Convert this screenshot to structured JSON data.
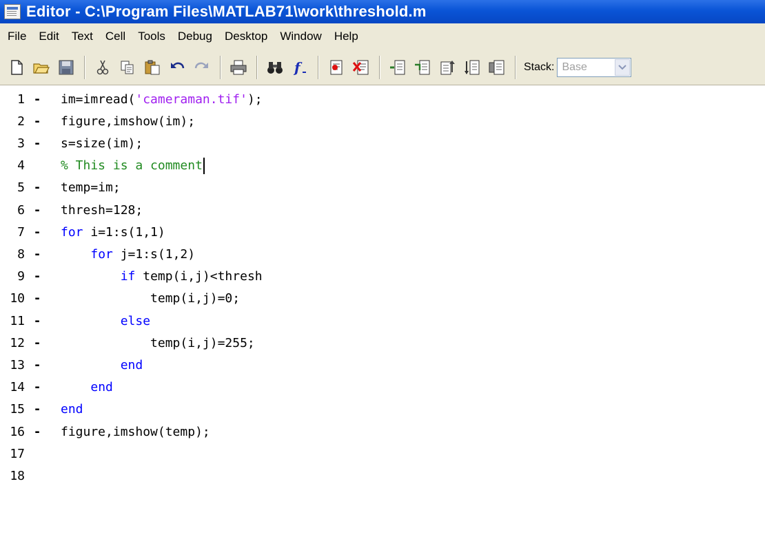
{
  "window": {
    "title": "Editor - C:\\Program Files\\MATLAB71\\work\\threshold.m"
  },
  "menu": [
    "File",
    "Edit",
    "Text",
    "Cell",
    "Tools",
    "Debug",
    "Desktop",
    "Window",
    "Help"
  ],
  "toolbar": {
    "stack_label": "Stack:",
    "stack_value": "Base",
    "buttons": [
      "new-file",
      "open",
      "save",
      "cut",
      "copy",
      "paste",
      "undo",
      "redo",
      "print",
      "find",
      "function",
      "set-breakpoint",
      "clear-breakpoints",
      "step",
      "step-in",
      "step-out",
      "continue",
      "exit-debug"
    ]
  },
  "editor": {
    "lines": [
      {
        "num": "1",
        "dash": "-",
        "indent": "",
        "parts": [
          {
            "t": "im=imread(",
            "c": ""
          },
          {
            "t": "'cameraman.tif'",
            "c": "str"
          },
          {
            "t": ");",
            "c": ""
          }
        ]
      },
      {
        "num": "2",
        "dash": "-",
        "indent": "",
        "parts": [
          {
            "t": "figure,imshow(im);",
            "c": ""
          }
        ]
      },
      {
        "num": "3",
        "dash": "-",
        "indent": "",
        "parts": [
          {
            "t": "s=size(im);",
            "c": ""
          }
        ]
      },
      {
        "num": "4",
        "dash": "",
        "indent": "",
        "parts": [
          {
            "t": "% This is a comment",
            "c": "cmt"
          }
        ],
        "caret": true
      },
      {
        "num": "5",
        "dash": "-",
        "indent": "",
        "parts": [
          {
            "t": "temp=im;",
            "c": ""
          }
        ]
      },
      {
        "num": "6",
        "dash": "-",
        "indent": "",
        "parts": [
          {
            "t": "thresh=128;",
            "c": ""
          }
        ]
      },
      {
        "num": "7",
        "dash": "-",
        "indent": "",
        "parts": [
          {
            "t": "for",
            "c": "kw"
          },
          {
            "t": " i=1:s(1,1)",
            "c": ""
          }
        ]
      },
      {
        "num": "8",
        "dash": "-",
        "indent": "    ",
        "parts": [
          {
            "t": "for",
            "c": "kw"
          },
          {
            "t": " j=1:s(1,2)",
            "c": ""
          }
        ]
      },
      {
        "num": "9",
        "dash": "-",
        "indent": "        ",
        "parts": [
          {
            "t": "if",
            "c": "kw"
          },
          {
            "t": " temp(i,j)<thresh",
            "c": ""
          }
        ]
      },
      {
        "num": "10",
        "dash": "-",
        "indent": "            ",
        "parts": [
          {
            "t": "temp(i,j)=0;",
            "c": ""
          }
        ]
      },
      {
        "num": "11",
        "dash": "-",
        "indent": "        ",
        "parts": [
          {
            "t": "else",
            "c": "kw"
          }
        ]
      },
      {
        "num": "12",
        "dash": "-",
        "indent": "            ",
        "parts": [
          {
            "t": "temp(i,j)=255;",
            "c": ""
          }
        ]
      },
      {
        "num": "13",
        "dash": "-",
        "indent": "        ",
        "parts": [
          {
            "t": "end",
            "c": "kw"
          }
        ]
      },
      {
        "num": "14",
        "dash": "-",
        "indent": "    ",
        "parts": [
          {
            "t": "end",
            "c": "kw"
          }
        ]
      },
      {
        "num": "15",
        "dash": "-",
        "indent": "",
        "parts": [
          {
            "t": "end",
            "c": "kw"
          }
        ]
      },
      {
        "num": "16",
        "dash": "-",
        "indent": "",
        "parts": [
          {
            "t": "figure,imshow(temp);",
            "c": ""
          }
        ]
      },
      {
        "num": "17",
        "dash": "",
        "indent": "",
        "parts": []
      },
      {
        "num": "18",
        "dash": "",
        "indent": "",
        "parts": []
      }
    ]
  },
  "colors": {
    "keyword": "#0000ff",
    "string": "#a020f0",
    "comment": "#228b22",
    "titlebar": "#0a54d6"
  }
}
